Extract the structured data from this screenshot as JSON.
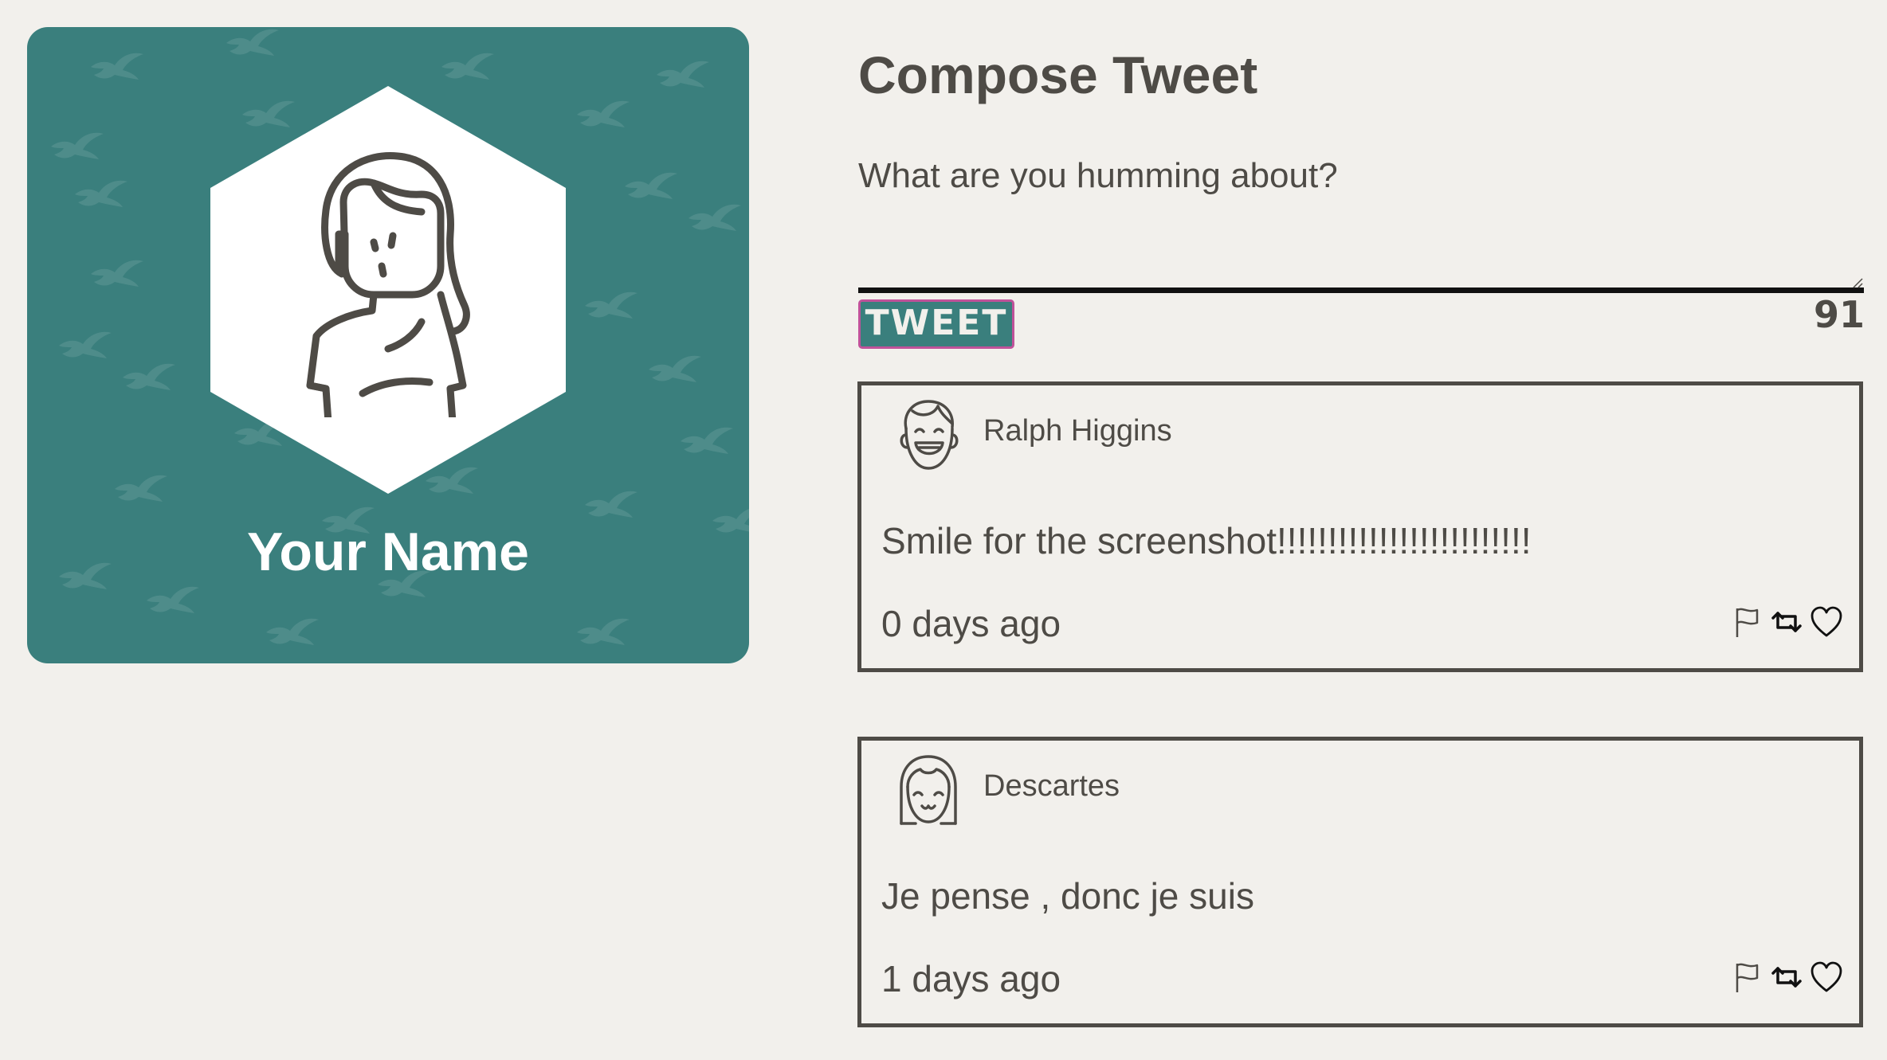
{
  "profile": {
    "name": "Your Name",
    "card_color": "#3a7f7d"
  },
  "compose": {
    "title": "Compose Tweet",
    "placeholder": "What are you humming about?",
    "tweet_button_label": "TWEET",
    "char_counter": "91"
  },
  "tweets": [
    {
      "author": "Ralph Higgins",
      "avatar_icon": "laughing-boy-avatar-icon",
      "content": "Smile for the screenshot!!!!!!!!!!!!!!!!!!!!!!!!!",
      "time": "0 days ago",
      "actions": [
        "flag-icon",
        "retweet-icon",
        "heart-icon"
      ]
    },
    {
      "author": "Descartes",
      "avatar_icon": "smiling-girl-avatar-icon",
      "content": "Je pense , donc je suis",
      "time": "1 days ago",
      "actions": [
        "flag-icon",
        "retweet-icon",
        "heart-icon"
      ]
    }
  ],
  "colors": {
    "background": "#f2f0ec",
    "text": "#4e4b46",
    "accent": "#3a7f7d",
    "button_border": "#c0529a"
  }
}
